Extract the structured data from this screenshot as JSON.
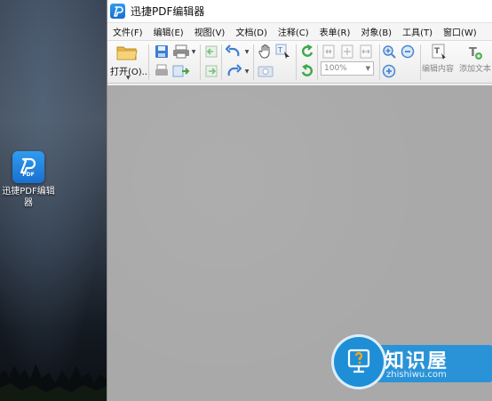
{
  "desktop": {
    "icon_label": "迅捷PDF编辑器"
  },
  "window": {
    "title": "迅捷PDF编辑器"
  },
  "menu": [
    "文件(F)",
    "编辑(E)",
    "视图(V)",
    "文档(D)",
    "注释(C)",
    "表单(R)",
    "对象(B)",
    "工具(T)",
    "窗口(W)"
  ],
  "toolbar": {
    "open_label": "打开(O)...",
    "zoom_value": "100%",
    "edit_content_label": "编辑内容",
    "add_text_label": "添加文本"
  },
  "watermark": {
    "title": "知识屋",
    "url": "zhishiwu.com"
  },
  "colors": {
    "accent": "#1a7fd8",
    "toolbar_bg": "#f0f0f0",
    "canvas_bg": "#a9a9a9"
  },
  "icons": [
    "folder-open-icon",
    "save-icon",
    "print-icon",
    "scan-icon",
    "page-extract-icon",
    "undo-icon",
    "redo-icon",
    "hand-icon",
    "select-text-icon",
    "snapshot-icon",
    "rotate-cw-icon",
    "rotate-ccw-icon",
    "fit-page-icon",
    "actual-size-icon",
    "fit-width-icon",
    "zoom-in-icon",
    "zoom-out-icon",
    "zoom-add-icon",
    "edit-content-icon",
    "add-text-icon"
  ]
}
